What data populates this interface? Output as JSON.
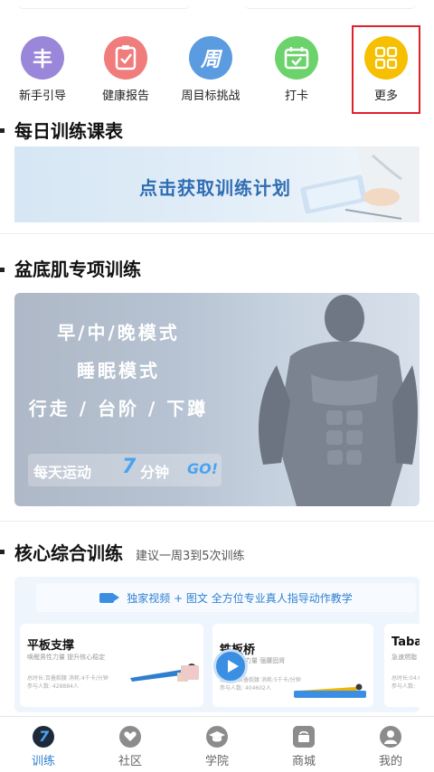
{
  "quick_actions": [
    {
      "label": "新手引导",
      "icon": "signpost-icon",
      "glyph": "丰",
      "color": "#9b87d9"
    },
    {
      "label": "健康报告",
      "icon": "report-icon",
      "glyph": "✓",
      "color": "#f07c7c"
    },
    {
      "label": "周目标挑战",
      "icon": "weekly-icon",
      "glyph": "周",
      "color": "#5b9be0"
    },
    {
      "label": "打卡",
      "icon": "calendar-check-icon",
      "glyph": "✓",
      "color": "#6cd36c"
    },
    {
      "label": "更多",
      "icon": "grid-icon",
      "glyph": "",
      "color": "#f6c000"
    }
  ],
  "daily_schedule": {
    "title": "每日训练课表",
    "banner_text": "点击获取训练计划"
  },
  "pelvic_training": {
    "title": "盆底肌专项训练",
    "lines": [
      "早/中/晚模式",
      "睡眠模式",
      "行走 / 台阶 / 下蹲"
    ],
    "go_prefix": "每天运动",
    "go_number": "7",
    "go_suffix": "分钟",
    "go_word": "GO!"
  },
  "core_training": {
    "title": "核心综合训练",
    "subtitle": "建议一周3到5次训练",
    "video_bar": "独家视频 + 图文  全方位专业真人指导动作教学",
    "exercises": [
      {
        "title": "平板支撑",
        "subtitle": "唤醒男性力量  提升核心稳定",
        "meta_1": "总时长:百叠毅腰    消耗:4千卡/分钟",
        "meta_2": "参与人数: 428884人"
      },
      {
        "title": "铁板桥",
        "subtitle": "加强腰腹力量  强腰固肾",
        "meta_1": "总时长:百叠毅腰    消耗:5千卡/分钟",
        "meta_2": "参与人数: 404602人"
      },
      {
        "title": "Tabat",
        "subtitle": "急速燃脂",
        "meta_1": "总时长:04:0",
        "meta_2": "参与人数:"
      }
    ]
  },
  "tabbar": [
    {
      "label": "训练",
      "icon": "training-icon",
      "active": true
    },
    {
      "label": "社区",
      "icon": "heart-chat-icon",
      "active": false
    },
    {
      "label": "学院",
      "icon": "graduation-cap-icon",
      "active": false
    },
    {
      "label": "商城",
      "icon": "shopping-bag-icon",
      "active": false
    },
    {
      "label": "我的",
      "icon": "user-icon",
      "active": false
    }
  ],
  "colors": {
    "accent": "#2f7fd0",
    "highlight": "#e0202a"
  }
}
